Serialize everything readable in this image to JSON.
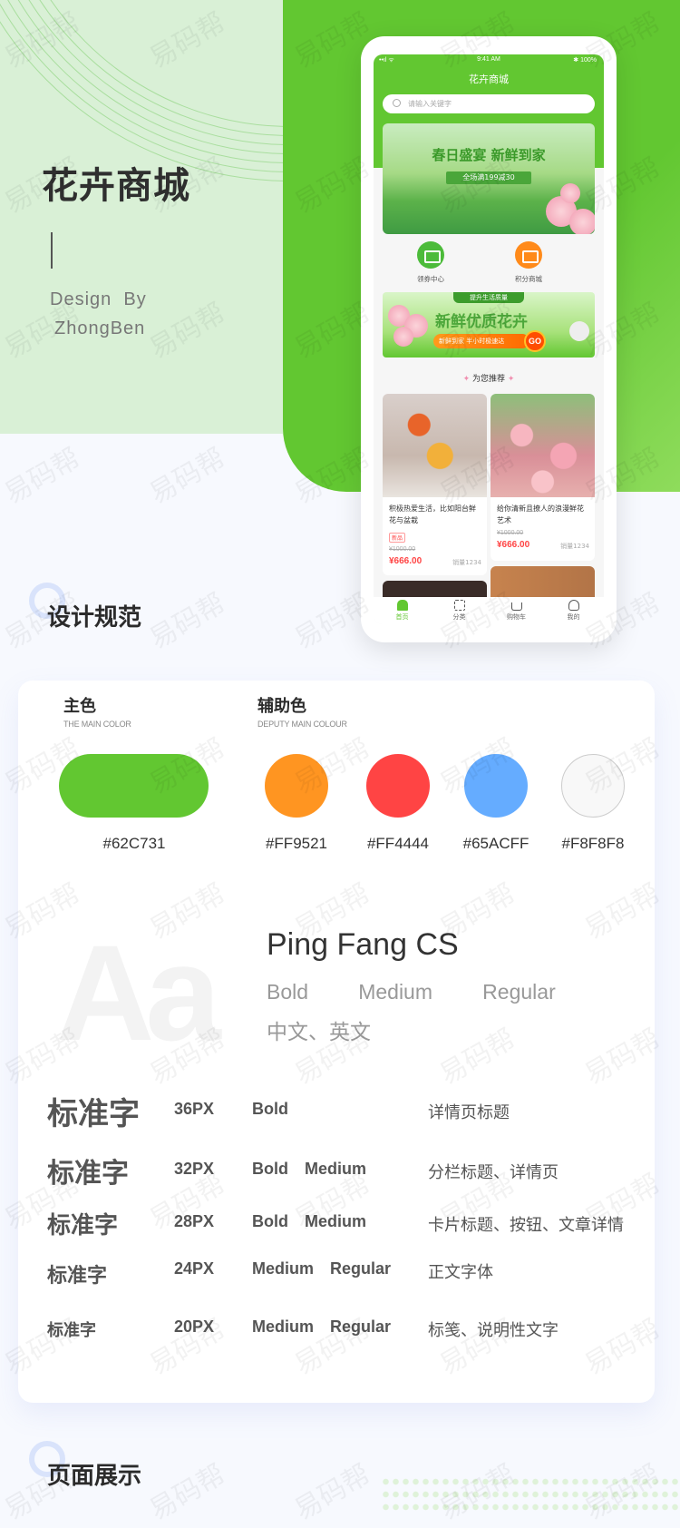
{
  "hero": {
    "title": "花卉商城",
    "design_by_line1": "Design  By",
    "design_by_line2": "ZhongBen"
  },
  "phone": {
    "status_bar": {
      "signal": "••ıl ᯤ",
      "time": "9:41 AM",
      "battery": "✱ 100%"
    },
    "app_title": "花卉商城",
    "search": {
      "placeholder": "请输入关键字"
    },
    "banner": {
      "title": "春日盛宴 新鲜到家",
      "subtitle": "全场满199减30"
    },
    "quick_entries": [
      {
        "label": "领券中心",
        "icon": "coupon-icon",
        "color": "#4cbb3a"
      },
      {
        "label": "积分商城",
        "icon": "store-icon",
        "color": "#ff8a1a"
      }
    ],
    "promo": {
      "tag": "提升生活质量",
      "title": "新鲜优质花卉",
      "bar": "新鲜到家  半小时极速达",
      "go": "GO"
    },
    "recommend_title": "为您推荐",
    "products": [
      {
        "name": "积极热爱生活，比如阳台鲜花与盆栽",
        "tag": "新品",
        "old_price": "¥1000.00",
        "price": "¥666.00",
        "sales": "销量1234"
      },
      {
        "name": "给你清新且撩人的浪漫鲜花艺术",
        "tag": "",
        "old_price": "¥1000.00",
        "price": "¥666.00",
        "sales": "销量1234"
      }
    ],
    "tabs": [
      {
        "label": "首页",
        "icon": "home-icon",
        "active": true
      },
      {
        "label": "分类",
        "icon": "category-grid-icon",
        "active": false
      },
      {
        "label": "购物车",
        "icon": "cart-icon",
        "active": false
      },
      {
        "label": "我的",
        "icon": "user-icon",
        "active": false
      }
    ]
  },
  "spec": {
    "section_title": "设计规范",
    "main_color": {
      "title": "主色",
      "subtitle": "THE MAIN COLOR",
      "hex": "#62C731"
    },
    "deputy_colors": {
      "title": "辅助色",
      "subtitle": "DEPUTY MAIN COLOUR",
      "items": [
        {
          "hex": "#FF9521"
        },
        {
          "hex": "#FF4444"
        },
        {
          "hex": "#65ACFF"
        },
        {
          "hex": "#F8F8F8"
        }
      ]
    },
    "font": {
      "sample": "Aa",
      "name": "Ping Fang CS",
      "weights": "Bold   Medium   Regular",
      "languages": "中文、英文"
    },
    "type_scale": [
      {
        "sample": "标准字",
        "size": "36PX",
        "weight": "Bold",
        "usage": "详情页标题"
      },
      {
        "sample": "标准字",
        "size": "32PX",
        "weight": "Bold  Medium",
        "usage": "分栏标题、详情页"
      },
      {
        "sample": "标准字",
        "size": "28PX",
        "weight": "Bold  Medium",
        "usage": "卡片标题、按钮、文章详情"
      },
      {
        "sample": "标准字",
        "size": "24PX",
        "weight": "Medium  Regular",
        "usage": "正文字体"
      },
      {
        "sample": "标准字",
        "size": "20PX",
        "weight": "Medium  Regular",
        "usage": "标笺、说明性文字"
      }
    ]
  },
  "showcase": {
    "section_title": "页面展示"
  },
  "watermark": "易码帮"
}
